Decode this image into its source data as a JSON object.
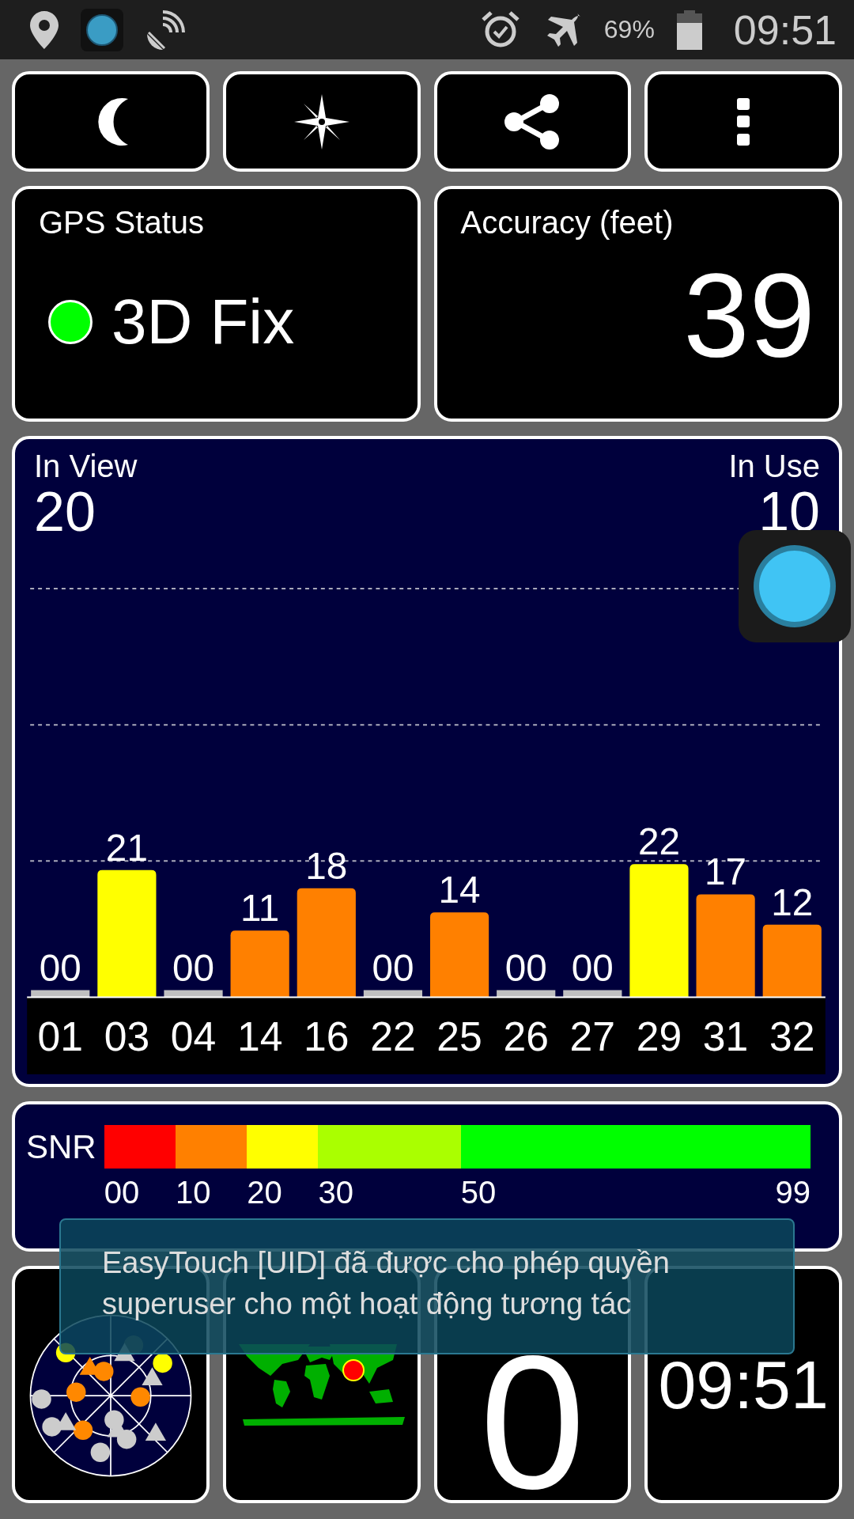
{
  "status_bar": {
    "battery": "69%",
    "time": "09:51"
  },
  "gps_status": {
    "title": "GPS Status",
    "status": "3D Fix",
    "color": "#00ff00"
  },
  "accuracy": {
    "title": "Accuracy (feet)",
    "value": "39"
  },
  "satellites": {
    "in_view_label": "In View",
    "in_view": "20",
    "in_use_label": "In Use",
    "in_use": "10",
    "chart_data": {
      "type": "bar",
      "categories": [
        "01",
        "03",
        "04",
        "14",
        "16",
        "22",
        "25",
        "26",
        "27",
        "29",
        "31",
        "32"
      ],
      "values": [
        0,
        21,
        0,
        11,
        18,
        0,
        14,
        0,
        0,
        22,
        17,
        12
      ],
      "value_labels": [
        "00",
        "21",
        "00",
        "11",
        "18",
        "00",
        "14",
        "00",
        "00",
        "22",
        "17",
        "12"
      ]
    }
  },
  "snr": {
    "label": "SNR",
    "segments": [
      {
        "color": "#ff0000"
      },
      {
        "color": "#ff8000"
      },
      {
        "color": "#ffff00"
      },
      {
        "color": "#aaff00"
      },
      {
        "color": "#00ff00"
      }
    ],
    "ticks": [
      "00",
      "10",
      "20",
      "30",
      "50",
      "99"
    ]
  },
  "tiles": [
    {
      "kind": "sky_plot"
    },
    {
      "kind": "world_map"
    },
    {
      "kind": "value",
      "text": "0"
    },
    {
      "kind": "clock",
      "text": "09:51"
    }
  ],
  "toast": {
    "text": "EasyTouch [UID] đã được cho phép quyền superuser cho một hoạt động tương tác"
  }
}
